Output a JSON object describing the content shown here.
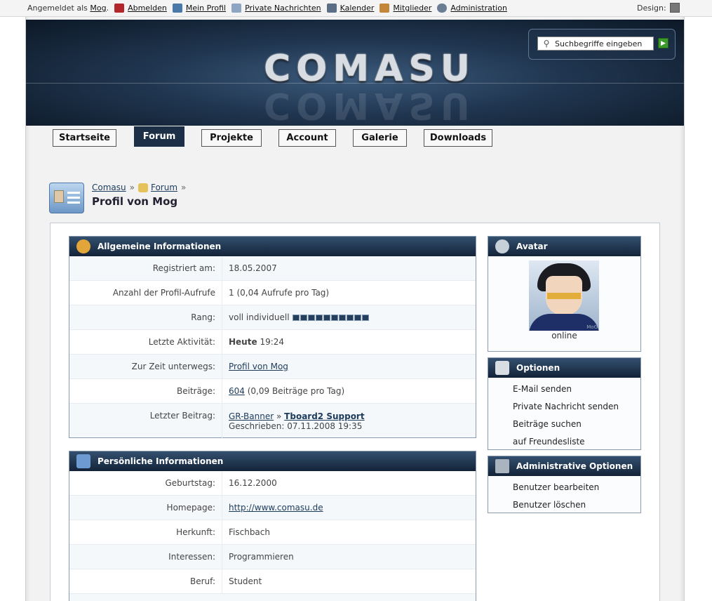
{
  "userbar": {
    "logged_prefix": "Angemeldet als",
    "username": "Mog",
    "username_suffix": ".",
    "items": [
      {
        "label": "Abmelden",
        "icon": "logout-icon",
        "color": "#b3262a"
      },
      {
        "label": "Mein Profil",
        "icon": "profile-card-icon",
        "color": "#4a78a8"
      },
      {
        "label": "Private Nachrichten",
        "icon": "envelope-icon",
        "color": "#8fa6c2"
      },
      {
        "label": "Kalender",
        "icon": "calendar-icon",
        "color": "#5a6f86"
      },
      {
        "label": "Mitglieder",
        "icon": "members-icon",
        "color": "#c4873a"
      },
      {
        "label": "Administration",
        "icon": "gear-icon",
        "color": "#6a7d93"
      }
    ],
    "design_label": "Design:"
  },
  "banner": {
    "logo_text": "COMASU",
    "search_placeholder": "Suchbegriffe eingeben"
  },
  "nav": {
    "tabs": [
      {
        "label": "Startseite",
        "active": false
      },
      {
        "label": "Forum",
        "active": true
      },
      {
        "label": "Projekte",
        "active": false
      },
      {
        "label": "Account",
        "active": false
      },
      {
        "label": "Galerie",
        "active": false
      },
      {
        "label": "Downloads",
        "active": false
      }
    ]
  },
  "breadcrumb": {
    "items": [
      "Comasu",
      "Forum"
    ],
    "separator": "»",
    "title": "Profil von Mog"
  },
  "general": {
    "title": "Allgemeine Informationen",
    "rows": [
      {
        "label": "Registriert am:",
        "value": "18.05.2007"
      },
      {
        "label": "Anzahl der Profil-Aufrufe",
        "value": "1 (0,04 Aufrufe pro Tag)"
      },
      {
        "label": "Rang:",
        "value": "voll individuell",
        "rank_blocks": 10
      },
      {
        "label": "Letzte Aktivität:",
        "value_bold": "Heute",
        "value": "19:24"
      },
      {
        "label": "Zur Zeit unterwegs:",
        "link": "Profil von Mog"
      },
      {
        "label": "Beiträge:",
        "link": "604",
        "value": "(0,09 Beiträge pro Tag)"
      },
      {
        "label": "Letzter Beitrag:",
        "link": "GR-Banner",
        "sep": "»",
        "link2": "Tboard2 Support",
        "sub": "Geschrieben: 07.11.2008 19:35"
      }
    ]
  },
  "personal": {
    "title": "Persönliche Informationen",
    "rows": [
      {
        "label": "Geburtstag:",
        "value": "16.12.2000"
      },
      {
        "label": "Homepage:",
        "link": "http://www.comasu.de"
      },
      {
        "label": "Herkunft:",
        "value": "Fischbach"
      },
      {
        "label": "Interessen:",
        "value": "Programmieren"
      },
      {
        "label": "Beruf:",
        "value": "Student"
      }
    ]
  },
  "avatar": {
    "title": "Avatar",
    "status": "online",
    "watermark": "MoG"
  },
  "options": {
    "title": "Optionen",
    "items": [
      "E-Mail senden",
      "Private Nachricht senden",
      "Beiträge suchen",
      "auf Freundesliste"
    ]
  },
  "admin_options": {
    "title": "Administrative Optionen",
    "items": [
      "Benutzer bearbeiten",
      "Benutzer löschen"
    ]
  },
  "colors": {
    "header_dark": "#132338",
    "header_light": "#33506f",
    "link": "#1c3b5c",
    "rank_block": "#25405f"
  }
}
